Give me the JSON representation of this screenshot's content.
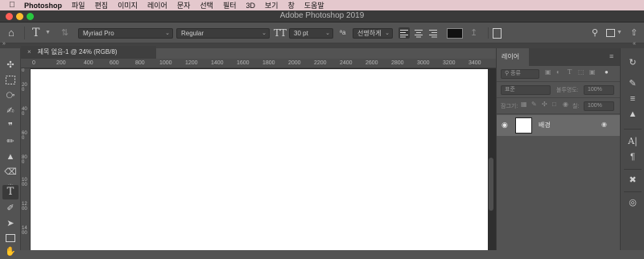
{
  "menubar": {
    "apple": "",
    "items": [
      "Photoshop",
      "파일",
      "편집",
      "이미지",
      "레이어",
      "문자",
      "선택",
      "필터",
      "3D",
      "보기",
      "창",
      "도움말"
    ]
  },
  "window": {
    "title": "Adobe Photoshop 2019"
  },
  "options": {
    "font_family": "Myriad Pro",
    "font_style": "Regular",
    "font_size": "30 pt",
    "antialias": "선명하게",
    "text_color": "#111111"
  },
  "document": {
    "tab_close": "×",
    "tab_title": "제목 없음-1 @ 24% (RGB/8)",
    "h_ruler": [
      "0",
      "200",
      "400",
      "600",
      "800",
      "1000",
      "1200",
      "1400",
      "1600",
      "1800",
      "2000",
      "2200",
      "2400",
      "2600",
      "2800",
      "3000",
      "3200",
      "3400"
    ],
    "v_ruler": [
      "0",
      "200",
      "400",
      "600",
      "800",
      "1000",
      "1200",
      "1400"
    ]
  },
  "layers_panel": {
    "tab": "레이어",
    "filter": "종류",
    "blend_mode": "표준",
    "opacity_label": "불투명도:",
    "opacity_value": "100%",
    "lock_label": "잠그기:",
    "fill_label": "칠:",
    "fill_value": "100%",
    "layer_name": "배경"
  },
  "colors": {
    "menubar": "#e4c8cd",
    "ui_bg": "#535353",
    "canvas": "#ffffff",
    "selected_layer": "#6a6a6a"
  }
}
